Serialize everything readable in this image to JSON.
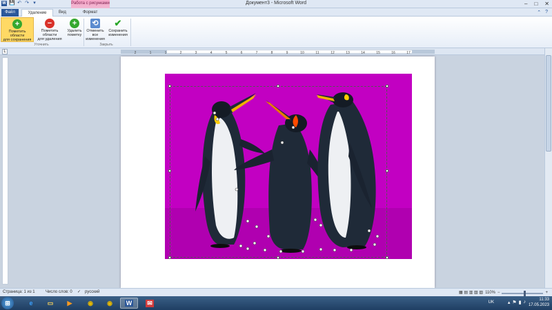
{
  "window": {
    "title": "Документ3 - Microsoft Word",
    "context_tab_title": "Работа с рисунками",
    "controls": [
      "–",
      "□",
      "✕"
    ]
  },
  "quick_access": [
    "W",
    "💾",
    "↶",
    "↷",
    "▾"
  ],
  "tabs": {
    "file": "Файл",
    "active": "Удаление фона",
    "view": "Вид",
    "format": "Формат"
  },
  "ribbon": {
    "buttons": [
      {
        "label_1": "Пометить области",
        "label_2": "для сохранения",
        "icon": "plus-icon"
      },
      {
        "label_1": "Пометить области",
        "label_2": "для удаления",
        "icon": "minus-icon"
      },
      {
        "label_1": "Удалить",
        "label_2": "пометку",
        "icon": "plus-icon"
      },
      {
        "label_1": "Отменить все",
        "label_2": "изменения",
        "icon": "cancel-icon"
      },
      {
        "label_1": "Сохранить",
        "label_2": "изменения",
        "icon": "check-icon"
      }
    ],
    "groups": [
      "Уточнить",
      "Закрыть"
    ]
  },
  "ruler": {
    "labels": [
      "2",
      "1",
      "1",
      "2",
      "3",
      "4",
      "5",
      "6",
      "7",
      "8",
      "9",
      "10",
      "11",
      "12",
      "13",
      "14",
      "15",
      "16",
      "17"
    ]
  },
  "statusbar": {
    "page": "Страница: 1 из 1",
    "words": "Число слов: 0",
    "language": "русский",
    "zoom": "110%"
  },
  "taskbar": {
    "lang": "UK",
    "time": "11:33",
    "date": "17.05.2023"
  },
  "colors": {
    "removed_background": "#c200c2"
  }
}
